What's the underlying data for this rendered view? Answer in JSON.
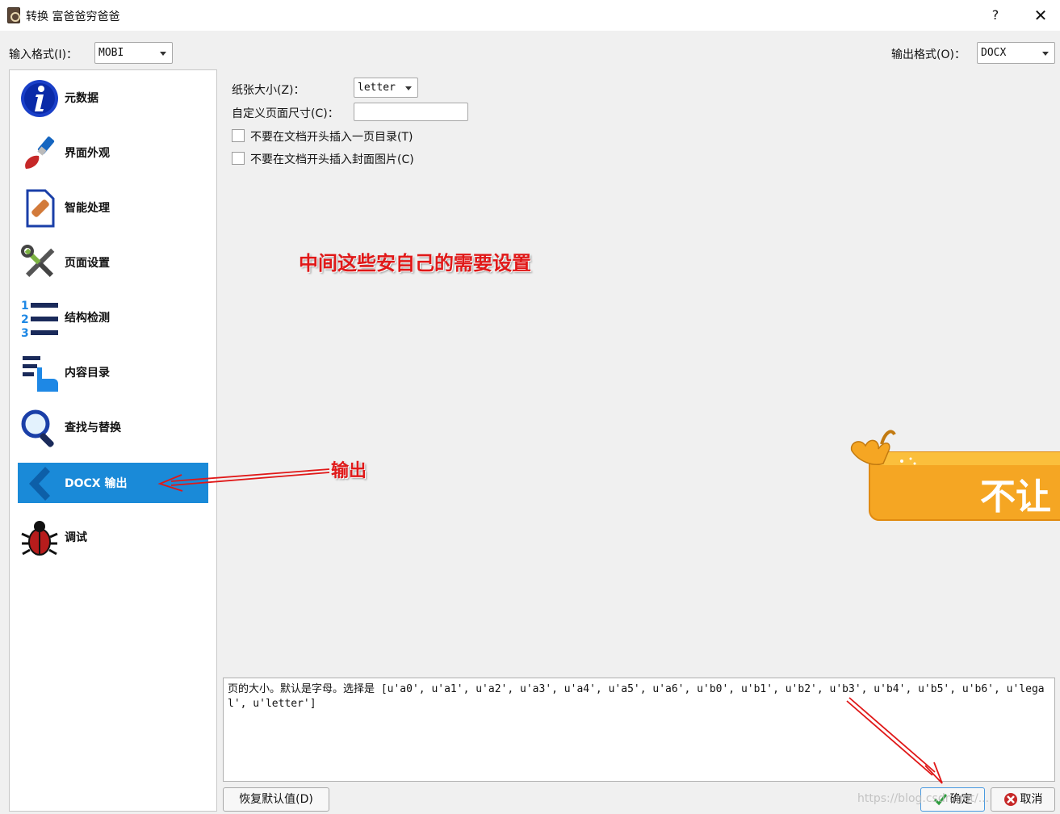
{
  "window": {
    "title": "转换 富爸爸穷爸爸",
    "help": "?",
    "close": "✕"
  },
  "input_format": {
    "label": "输入格式(I)：",
    "value": "MOBI"
  },
  "output_format": {
    "label": "输出格式(O)：",
    "value": "DOCX"
  },
  "sidebar": {
    "items": [
      {
        "label": "元数据",
        "icon": "info-icon"
      },
      {
        "label": "界面外观",
        "icon": "paintbrush-icon"
      },
      {
        "label": "智能处理",
        "icon": "document-bandage-icon"
      },
      {
        "label": "页面设置",
        "icon": "tools-icon"
      },
      {
        "label": "结构检测",
        "icon": "numbered-list-icon"
      },
      {
        "label": "内容目录",
        "icon": "toc-pointer-icon"
      },
      {
        "label": "查找与替换",
        "icon": "magnifier-icon"
      },
      {
        "label": "DOCX 输出",
        "icon": "chevron-left-icon",
        "selected": true
      },
      {
        "label": "调试",
        "icon": "bug-icon"
      }
    ]
  },
  "options": {
    "paper_size_label": "纸张大小(Z)：",
    "paper_size_value": "letter",
    "custom_size_label": "自定义页面尺寸(C)：",
    "custom_size_value": "",
    "no_toc_label": "不要在文档开头插入一页目录(T)",
    "no_cover_label": "不要在文档开头插入封面图片(C)"
  },
  "annotations": {
    "middle": "中间这些安自己的需要设置",
    "output": "输出"
  },
  "banner": {
    "text": "不让"
  },
  "help_text": "页的大小。默认是字母。选择是 [u'a0', u'a1', u'a2', u'a3', u'a4', u'a5', u'a6', u'b0', u'b1', u'b2', u'b3', u'b4', u'b5', u'b6', u'legal', u'letter']",
  "buttons": {
    "restore": "恢复默认值(D)",
    "ok": "确定",
    "cancel": "取消"
  },
  "watermark": "https://blog.csdn.net/..."
}
